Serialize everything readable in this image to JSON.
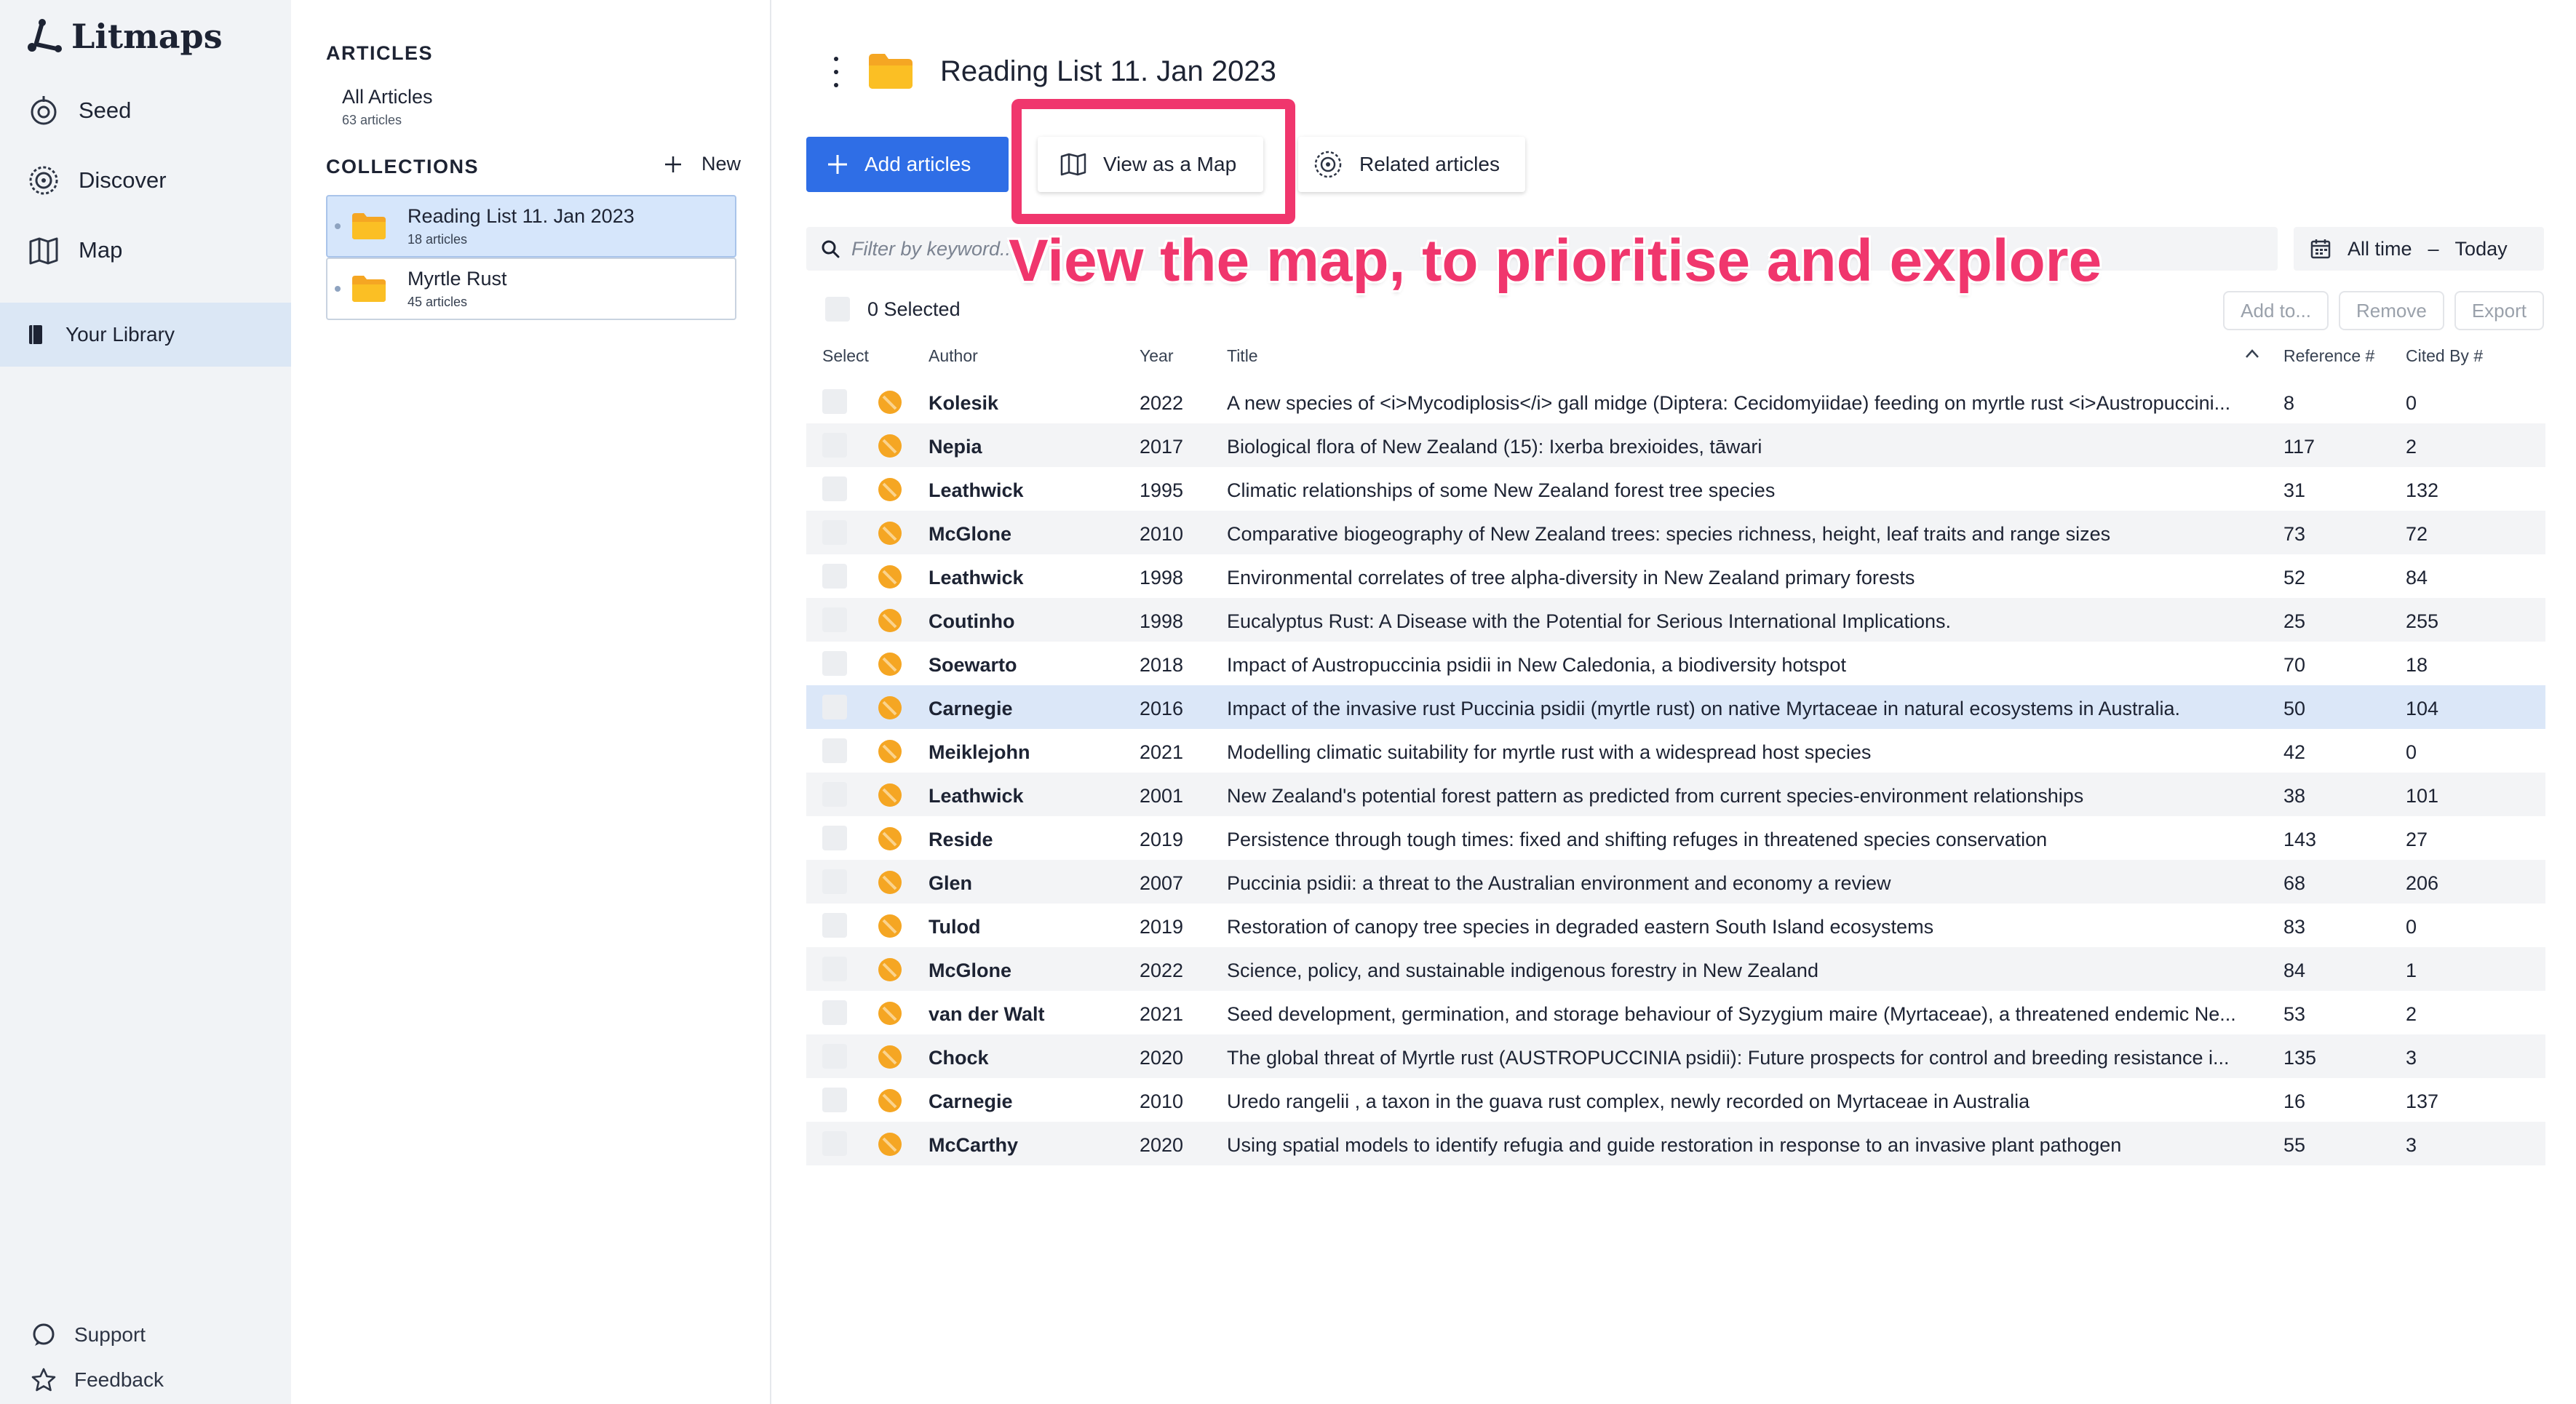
{
  "app": {
    "name": "Litmaps",
    "brand_color": "#2f6ee6",
    "highlight_color": "#f0366d"
  },
  "nav": {
    "items": [
      {
        "label": "Seed",
        "icon": "seed-icon"
      },
      {
        "label": "Discover",
        "icon": "discover-icon"
      },
      {
        "label": "Map",
        "icon": "map-icon"
      }
    ],
    "library": {
      "label": "Your Library",
      "icon": "book-icon"
    },
    "footer": [
      {
        "label": "Support",
        "icon": "chat-icon"
      },
      {
        "label": "Feedback",
        "icon": "star-icon"
      }
    ]
  },
  "library_panel": {
    "articles_heading": "ARTICLES",
    "all_articles": {
      "label": "All Articles",
      "count": "63 articles"
    },
    "collections_heading": "COLLECTIONS",
    "new_label": "New",
    "collections": [
      {
        "name": "Reading List 11. Jan 2023",
        "count": "18 articles",
        "active": true
      },
      {
        "name": "Myrtle Rust",
        "count": "45 articles",
        "active": false
      }
    ]
  },
  "main": {
    "title": "Reading List 11. Jan 2023",
    "buttons": {
      "add": "Add articles",
      "view_map": "View as a Map",
      "related": "Related articles"
    },
    "filter_placeholder": "Filter by keyword...",
    "date_range": {
      "from": "All time",
      "sep": "–",
      "to": "Today"
    },
    "annotation": "View the map, to prioritise and explore",
    "selected_label": "0 Selected",
    "actions": [
      "Add to...",
      "Remove",
      "Export"
    ],
    "columns": {
      "select": "Select",
      "author": "Author",
      "year": "Year",
      "title": "Title",
      "reference": "Reference #",
      "cited_by": "Cited By #"
    },
    "rows": [
      {
        "author": "Kolesik",
        "year": "2022",
        "title": "A new species of <i>Mycodiplosis</i> gall midge (Diptera: Cecidomyiidae) feeding on myrtle rust <i>Austropuccini...",
        "ref": "8",
        "cited": "0"
      },
      {
        "author": "Nepia",
        "year": "2017",
        "title": "Biological flora of New Zealand (15): Ixerba brexioides, tāwari",
        "ref": "117",
        "cited": "2"
      },
      {
        "author": "Leathwick",
        "year": "1995",
        "title": "Climatic relationships of some New Zealand forest tree species",
        "ref": "31",
        "cited": "132"
      },
      {
        "author": "McGlone",
        "year": "2010",
        "title": "Comparative biogeography of New Zealand trees: species richness, height, leaf traits and range sizes",
        "ref": "73",
        "cited": "72"
      },
      {
        "author": "Leathwick",
        "year": "1998",
        "title": "Environmental correlates of tree alpha-diversity in New Zealand primary forests",
        "ref": "52",
        "cited": "84"
      },
      {
        "author": "Coutinho",
        "year": "1998",
        "title": "Eucalyptus Rust: A Disease with the Potential for Serious International Implications.",
        "ref": "25",
        "cited": "255"
      },
      {
        "author": "Soewarto",
        "year": "2018",
        "title": "Impact of Austropuccinia psidii in New Caledonia, a biodiversity hotspot",
        "ref": "70",
        "cited": "18"
      },
      {
        "author": "Carnegie",
        "year": "2016",
        "title": "Impact of the invasive rust Puccinia psidii (myrtle rust) on native Myrtaceae in natural ecosystems in Australia.",
        "ref": "50",
        "cited": "104",
        "selected": true
      },
      {
        "author": "Meiklejohn",
        "year": "2021",
        "title": "Modelling climatic suitability for myrtle rust with a widespread host species",
        "ref": "42",
        "cited": "0"
      },
      {
        "author": "Leathwick",
        "year": "2001",
        "title": "New Zealand's potential forest pattern as predicted from current species-environment relationships",
        "ref": "38",
        "cited": "101"
      },
      {
        "author": "Reside",
        "year": "2019",
        "title": "Persistence through tough times: fixed and shifting refuges in threatened species conservation",
        "ref": "143",
        "cited": "27"
      },
      {
        "author": "Glen",
        "year": "2007",
        "title": "Puccinia psidii: a threat to the Australian environment and economy a review",
        "ref": "68",
        "cited": "206"
      },
      {
        "author": "Tulod",
        "year": "2019",
        "title": "Restoration of canopy tree species in degraded eastern South Island ecosystems",
        "ref": "83",
        "cited": "0"
      },
      {
        "author": "McGlone",
        "year": "2022",
        "title": "Science, policy, and sustainable indigenous forestry in New Zealand",
        "ref": "84",
        "cited": "1"
      },
      {
        "author": "van der Walt",
        "year": "2021",
        "title": "Seed development, germination, and storage behaviour of Syzygium maire (Myrtaceae), a threatened endemic Ne...",
        "ref": "53",
        "cited": "2"
      },
      {
        "author": "Chock",
        "year": "2020",
        "title": "The global threat of Myrtle rust (AUSTROPUCCINIA psidii): Future prospects for control and breeding resistance i...",
        "ref": "135",
        "cited": "3"
      },
      {
        "author": "Carnegie",
        "year": "2010",
        "title": "Uredo rangelii , a taxon in the guava rust complex, newly recorded on Myrtaceae in Australia",
        "ref": "16",
        "cited": "137"
      },
      {
        "author": "McCarthy",
        "year": "2020",
        "title": "Using spatial models to identify refugia and guide restoration in response to an invasive plant pathogen",
        "ref": "55",
        "cited": "3"
      }
    ]
  }
}
